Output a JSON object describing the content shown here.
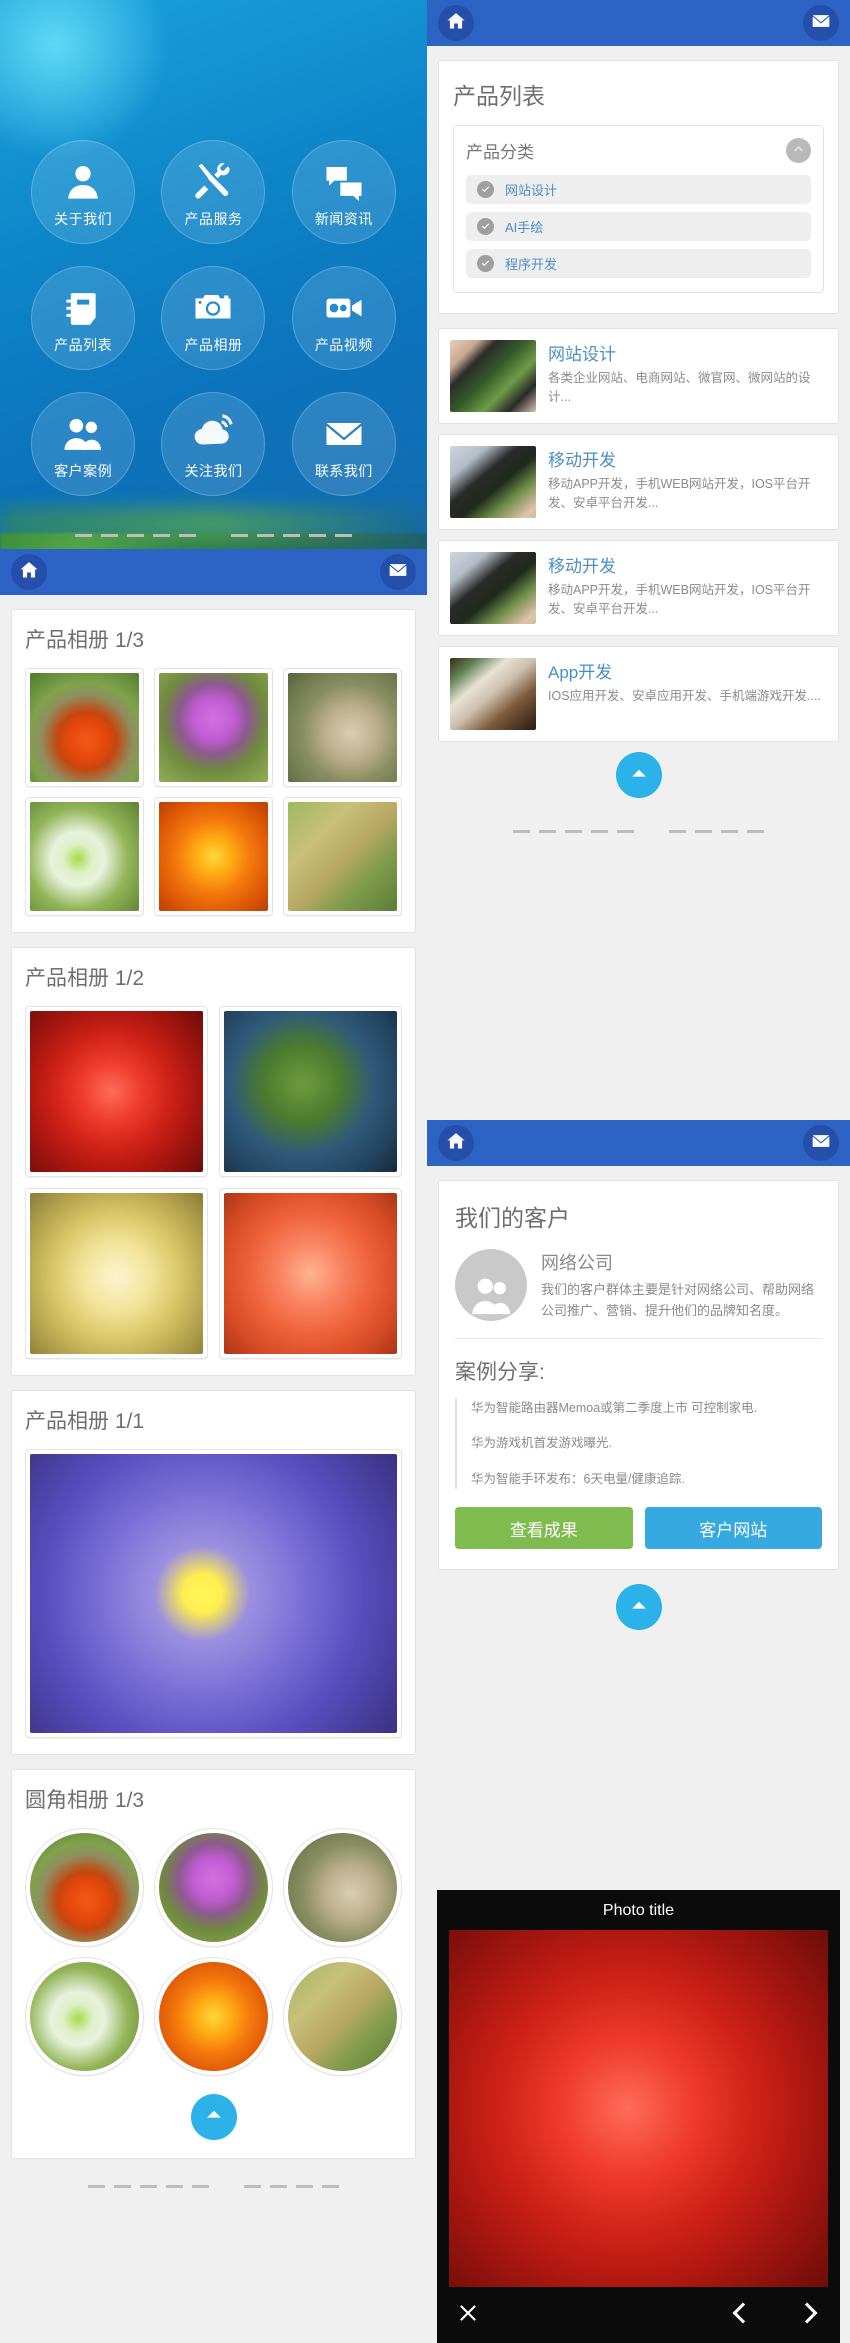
{
  "home_menu": {
    "items": [
      {
        "label": "关于我们",
        "icon": "user-icon"
      },
      {
        "label": "产品服务",
        "icon": "tools-icon"
      },
      {
        "label": "新闻资讯",
        "icon": "chat-bubbles-icon"
      },
      {
        "label": "产品列表",
        "icon": "notebook-icon"
      },
      {
        "label": "产品相册",
        "icon": "camera-icon"
      },
      {
        "label": "产品视频",
        "icon": "video-camera-icon"
      },
      {
        "label": "客户案例",
        "icon": "people-icon"
      },
      {
        "label": "关注我们",
        "icon": "cloud-wifi-icon"
      },
      {
        "label": "联系我们",
        "icon": "envelope-icon"
      }
    ]
  },
  "appbar": {
    "home_icon": "home-icon",
    "mail_icon": "envelope-icon"
  },
  "album_panel": {
    "sections": [
      {
        "title": "产品相册 1/3",
        "layout": "three",
        "photos": [
          {
            "name": "orange-bell-flower",
            "fill": "ph-orange-bell"
          },
          {
            "name": "purple-thistle-bee",
            "fill": "ph-purple-thistle"
          },
          {
            "name": "cactus-blooms",
            "fill": "ph-cactus"
          },
          {
            "name": "white-daisy",
            "fill": "ph-daisy"
          },
          {
            "name": "orange-marigold",
            "fill": "ph-marigold"
          },
          {
            "name": "wheat-grass",
            "fill": "ph-wheat"
          }
        ]
      },
      {
        "title": "产品相册 1/2",
        "layout": "two",
        "photos": [
          {
            "name": "red-rose",
            "fill": "ph-rose"
          },
          {
            "name": "blue-berries",
            "fill": "ph-berries"
          },
          {
            "name": "bee-on-chrysanthemum",
            "fill": "ph-bee-mum"
          },
          {
            "name": "coral-chrysanthemum",
            "fill": "ph-coral-mum"
          }
        ]
      },
      {
        "title": "产品相册 1/1",
        "layout": "one",
        "photos": [
          {
            "name": "purple-aster",
            "fill": "ph-purple-aster"
          }
        ]
      },
      {
        "title": "圆角相册 1/3",
        "layout": "three-round",
        "photos": [
          {
            "name": "orange-bell-flower",
            "fill": "ph-orange-bell"
          },
          {
            "name": "purple-thistle-bee",
            "fill": "ph-purple-thistle"
          },
          {
            "name": "cactus-blooms",
            "fill": "ph-cactus"
          },
          {
            "name": "white-daisy",
            "fill": "ph-daisy"
          },
          {
            "name": "orange-marigold",
            "fill": "ph-marigold"
          },
          {
            "name": "wheat-grass",
            "fill": "ph-wheat"
          }
        ]
      }
    ],
    "scroll_top_icon": "chevron-up-icon"
  },
  "product_panel": {
    "title": "产品列表",
    "category_box": {
      "label": "产品分类",
      "collapse_icon": "chevron-up-icon",
      "items": [
        {
          "label": "网站设计",
          "icon": "check-circle-icon"
        },
        {
          "label": "AI手绘",
          "icon": "check-circle-icon"
        },
        {
          "label": "程序开发",
          "icon": "check-circle-icon"
        }
      ]
    },
    "products": [
      {
        "name": "网站设计",
        "desc": "各类企业网站、电商网站、微官网、微网站的设计...",
        "thumb": "ph-phone-green",
        "thumb_name": "phone-in-hand-green-photo"
      },
      {
        "name": "移动开发",
        "desc": "移动APP开发，手机WEB网站开发，IOS平台开发、安卓平台开发...",
        "thumb": "ph-phone-city",
        "thumb_name": "phone-in-hand-city-photo"
      },
      {
        "name": "移动开发",
        "desc": "移动APP开发，手机WEB网站开发，IOS平台开发、安卓平台开发...",
        "thumb": "ph-phone-city",
        "thumb_name": "phone-in-hand-city-photo"
      },
      {
        "name": "App开发",
        "desc": "IOS应用开发、安卓应用开发、手机端游戏开发....",
        "thumb": "ph-coffee",
        "thumb_name": "phone-coffee-app-photo"
      }
    ],
    "scroll_top_icon": "chevron-up-icon"
  },
  "customer_panel": {
    "title": "我们的客户",
    "customer": {
      "name": "网络公司",
      "desc": "我们的客户群体主要是针对网络公司、帮助网络公司推广、营销、提升他们的品牌知名度。",
      "avatar_icon": "people-icon"
    },
    "case_title": "案例分享:",
    "cases": [
      "华为智能路由器Memoa或第二季度上市 可控制家电.",
      "华为游戏机首发游戏曝光.",
      "华为智能手环发布：6天电量/健康追踪."
    ],
    "buttons": {
      "primary": "查看成果",
      "secondary": "客户网站"
    },
    "scroll_top_icon": "chevron-up-icon"
  },
  "photo_viewer": {
    "title": "Photo title",
    "photo_name": "red-rose-closeup",
    "photo_fill": "ph-rose",
    "close_icon": "close-icon",
    "prev_icon": "chevron-left-icon",
    "next_icon": "chevron-right-icon"
  },
  "colors": {
    "appbar": "#2c63c4",
    "accent_blue": "#2bb2e8",
    "link_blue": "#4a90c7",
    "btn_green": "#7fbb4e",
    "btn_blue": "#36a9e0"
  }
}
